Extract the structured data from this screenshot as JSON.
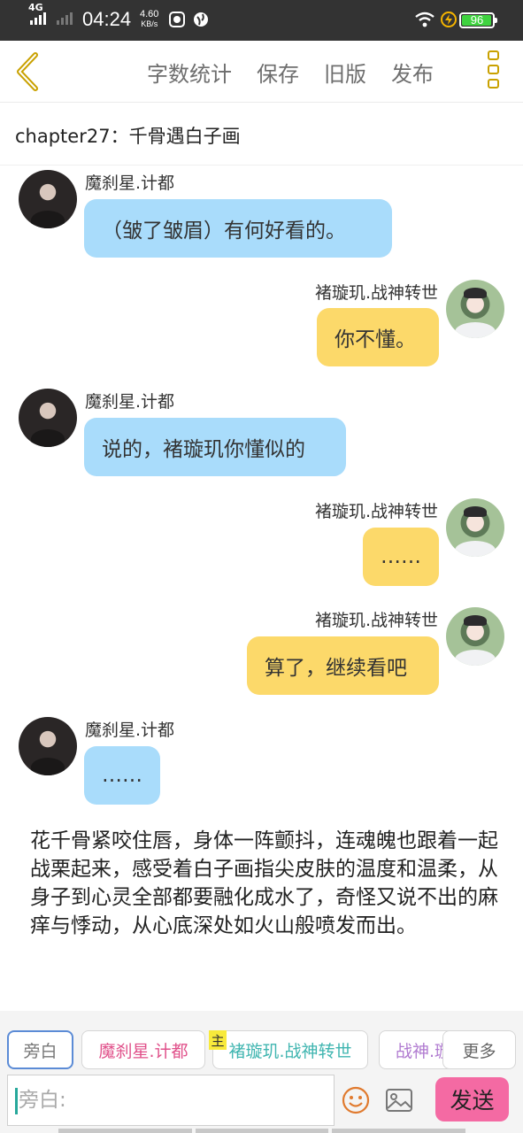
{
  "status_bar": {
    "network": "4G",
    "time": "04:24",
    "speed_value": "4.60",
    "speed_unit": "KB/s",
    "battery": "96"
  },
  "toolbar": {
    "actions": [
      "字数统计",
      "保存",
      "旧版",
      "发布"
    ]
  },
  "chapter_title": "chapter27：千骨遇白子画",
  "messages": [
    {
      "speaker": "魔刹星.计都",
      "text": "（皱了皱眉）有何好看的。"
    },
    {
      "speaker": "褚璇玑.战神转世",
      "text": "你不懂。"
    },
    {
      "speaker": "魔刹星.计都",
      "text": "说的，褚璇玑你懂似的"
    },
    {
      "speaker": "褚璇玑.战神转世",
      "text": "……"
    },
    {
      "speaker": "褚璇玑.战神转世",
      "text": "算了，继续看吧"
    },
    {
      "speaker": "魔刹星.计都",
      "text": "……"
    }
  ],
  "narration": "花千骨紧咬住唇，身体一阵颤抖，连魂魄也跟着一起战栗起来，感受着白子画指尖皮肤的温度和温柔，从身子到心灵全部都要融化成水了，奇怪又说不出的麻痒与悸动，从心底深处如火山般喷发而出。",
  "role_bar": {
    "chips": [
      "旁白",
      "魔刹星.计都",
      "褚璇玑.战神转世",
      "战神.璇"
    ],
    "main_badge": "主",
    "more_label": "更多"
  },
  "composer": {
    "placeholder": "旁白:",
    "send_label": "发送"
  },
  "colors": {
    "left_bubble": "#a9dcfb",
    "right_bubble": "#fcd96a",
    "send_button": "#f46aa3",
    "accent_yellow": "#c9a100"
  }
}
